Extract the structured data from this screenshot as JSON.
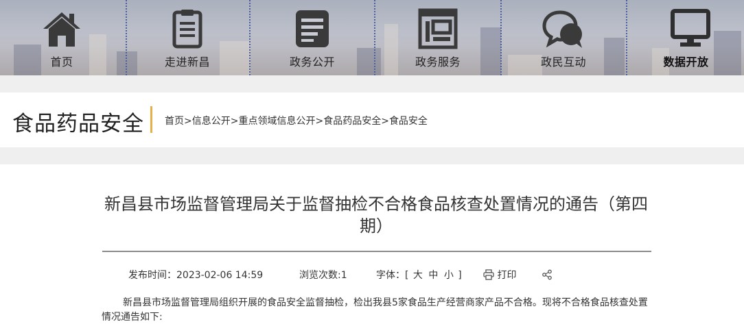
{
  "nav": {
    "items": [
      {
        "label": "首页",
        "icon": "home-icon"
      },
      {
        "label": "走进新昌",
        "icon": "clipboard-icon"
      },
      {
        "label": "政务公开",
        "icon": "document-icon"
      },
      {
        "label": "政务服务",
        "icon": "service-frame-icon"
      },
      {
        "label": "政民互动",
        "icon": "chat-bubbles-icon"
      },
      {
        "label": "数据开放",
        "icon": "monitor-icon"
      }
    ],
    "active_index": 5,
    "separator_color": "#4a5ea0"
  },
  "section": {
    "title": "食品药品安全",
    "accent_color": "#e8b04a",
    "breadcrumb": [
      "首页",
      "信息公开",
      "重点领域信息公开",
      "食品药品安全",
      "食品安全"
    ],
    "breadcrumb_separator": ">"
  },
  "article": {
    "title": "新昌县市场监督管理局关于监督抽检不合格食品核查处置情况的通告（第四期）",
    "publish_label": "发布时间：",
    "publish_time": "2023-02-06 14:59",
    "views_label": "浏览次数:",
    "views": "1",
    "font_label": "字体：",
    "font_open": "[",
    "font_large": "大",
    "font_medium": "中",
    "font_small": "小",
    "font_close": "]",
    "print_label": "打印",
    "body": "新昌县市场监督管理局组织开展的食品安全监督抽检，检出我县5家食品生产经营商家产品不合格。现将不合格食品核查处置情况通告如下:"
  }
}
